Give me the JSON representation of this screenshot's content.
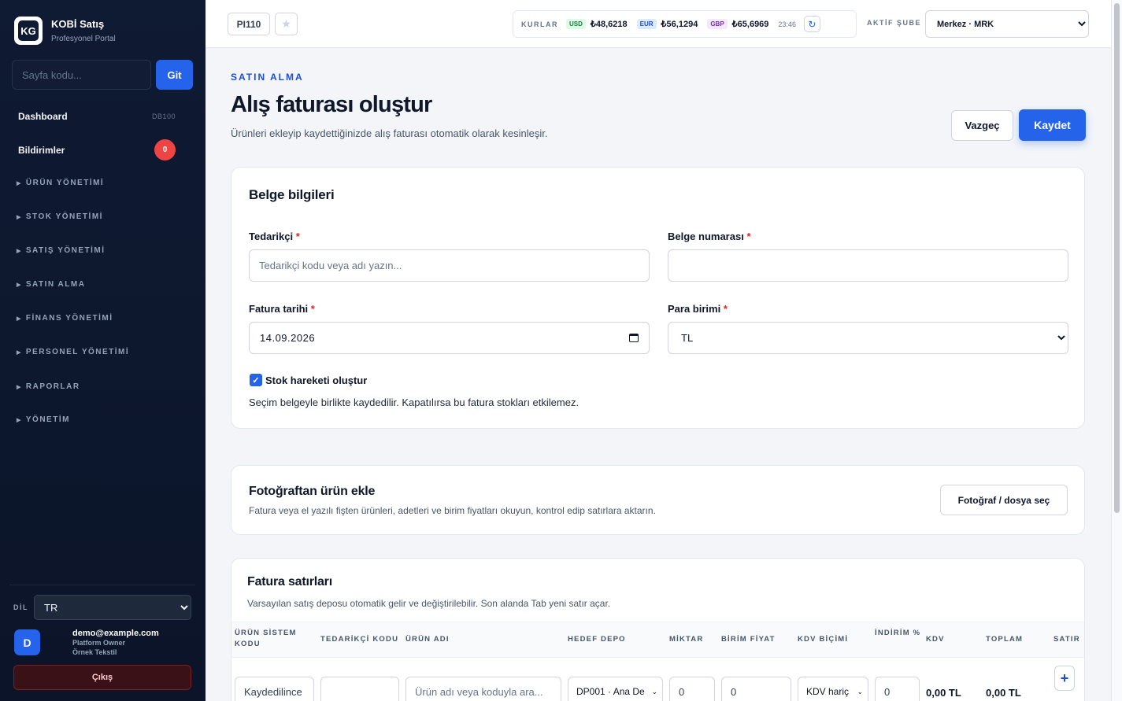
{
  "sidebar": {
    "brand_logo": "KG",
    "brand_name": "KOBİ Satış",
    "brand_sub": "Profesyonel Portal",
    "page_code_placeholder": "Sayfa kodu...",
    "go_label": "Git",
    "dashboard": {
      "label": "Dashboard",
      "code": "DB100"
    },
    "notifications": {
      "label": "Bildirimler",
      "count": "0"
    },
    "groups": [
      "ÜRÜN YÖNETİMİ",
      "STOK YÖNETİMİ",
      "SATIŞ YÖNETİMİ",
      "SATIN ALMA",
      "FİNANS YÖNETİMİ",
      "PERSONEL YÖNETİMİ",
      "RAPORLAR",
      "YÖNETİM"
    ],
    "lang_label": "DİL",
    "lang_value": "TR",
    "user": {
      "initial": "D",
      "email": "demo@example.com",
      "role": "Platform Owner",
      "company": "Örnek Tekstil"
    },
    "logout_label": "Çıkış"
  },
  "topbar": {
    "page_code": "PI110",
    "rates_label": "KURLAR",
    "rates": [
      {
        "code": "USD",
        "value": "₺48,6218"
      },
      {
        "code": "EUR",
        "value": "₺56,1294"
      },
      {
        "code": "GBP",
        "value": "₺65,6969"
      }
    ],
    "rates_time": "23:46",
    "branch_label": "AKTİF ŞUBE",
    "branch_value": "Merkez · MRK"
  },
  "header": {
    "eyebrow": "SATIN ALMA",
    "title": "Alış faturası oluştur",
    "subtitle": "Ürünleri ekleyip kaydettiğinizde alış faturası otomatik olarak kesinleşir.",
    "cancel_label": "Vazgeç",
    "save_label": "Kaydet"
  },
  "document": {
    "title": "Belge bilgileri",
    "supplier_label": "Tedarikçi",
    "supplier_placeholder": "Tedarikçi kodu veya adı yazın...",
    "doc_number_label": "Belge numarası",
    "date_label": "Fatura tarihi",
    "date_value": "14.09.2026",
    "currency_label": "Para birimi",
    "currency_value": "TL",
    "required_mark": "*",
    "stock_check_label": "Stok hareketi oluştur",
    "stock_note": "Seçim belgeyle birlikte kaydedilir. Kapatılırsa bu fatura stokları etkilemez."
  },
  "photo": {
    "title": "Fotoğraftan ürün ekle",
    "desc": "Fatura veya el yazılı fişten ürünleri, adetleri ve birim fiyatları okuyun, kontrol edip satırlara aktarın.",
    "button": "Fotoğraf / dosya seç"
  },
  "lines": {
    "title": "Fatura satırları",
    "desc": "Varsayılan satış deposu otomatik gelir ve değiştirilebilir. Son alanda Tab yeni satır açar.",
    "columns": [
      "ÜRÜN SİSTEM KODU",
      "TEDARİKÇİ KODU",
      "ÜRÜN ADI",
      "HEDEF DEPO",
      "MİKTAR",
      "BİRİM FİYAT",
      "KDV BİÇİMİ",
      "İNDİRİM %",
      "KDV",
      "TOPLAM",
      "SATIR"
    ],
    "row": {
      "system_code": "Kaydedilince",
      "product_placeholder": "Ürün adı veya koduyla ara...",
      "warehouse": "DP001 · Ana De",
      "qty": "0",
      "unit_price": "0",
      "vat_mode": "KDV hariç",
      "discount": "0",
      "vat": "0,00 TL",
      "total": "0,00 TL",
      "add_icon": "plus-icon"
    }
  }
}
